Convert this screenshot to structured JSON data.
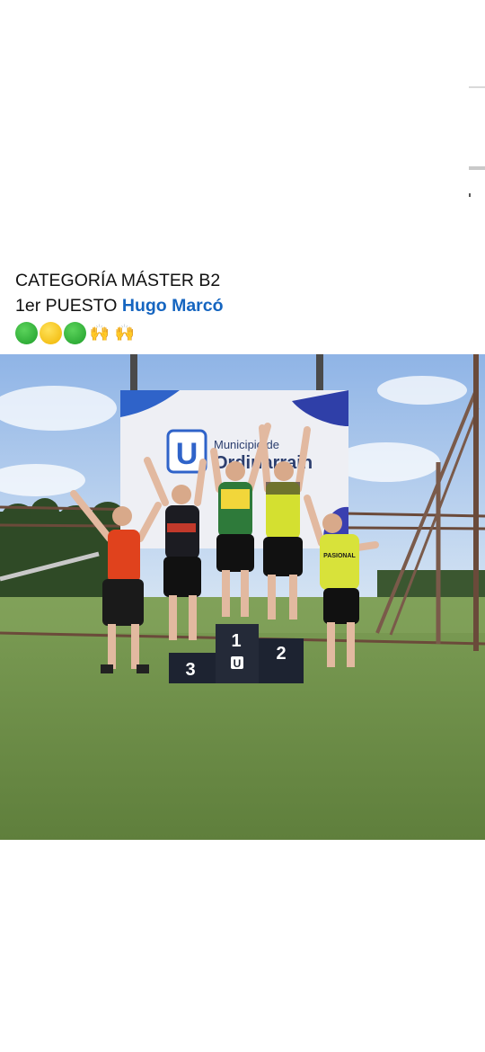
{
  "post": {
    "line1": "CATEGORÍA MÁSTER B2",
    "line2_prefix": "1er PUESTO ",
    "line2_mention": "Hugo Marcó",
    "emojis": [
      "green-circle",
      "yellow-circle",
      "green-circle",
      "raising-hands",
      "raising-hands"
    ],
    "hands_glyph": "🙌"
  },
  "photo": {
    "banner_text_line1": "Municipio de",
    "banner_text_line2": "Ordiriarrain",
    "banner_logo_letter": "U",
    "podium_1": "1",
    "podium_2": "2",
    "podium_3": "3",
    "podium_logo": "U",
    "jersey_text": "PASIONAL"
  },
  "colors": {
    "mention": "#1565c0",
    "banner_blue": "#2f63c9",
    "grass": "#6d8e47",
    "sky": "#a9c7ea",
    "podium": "#1d2331"
  }
}
